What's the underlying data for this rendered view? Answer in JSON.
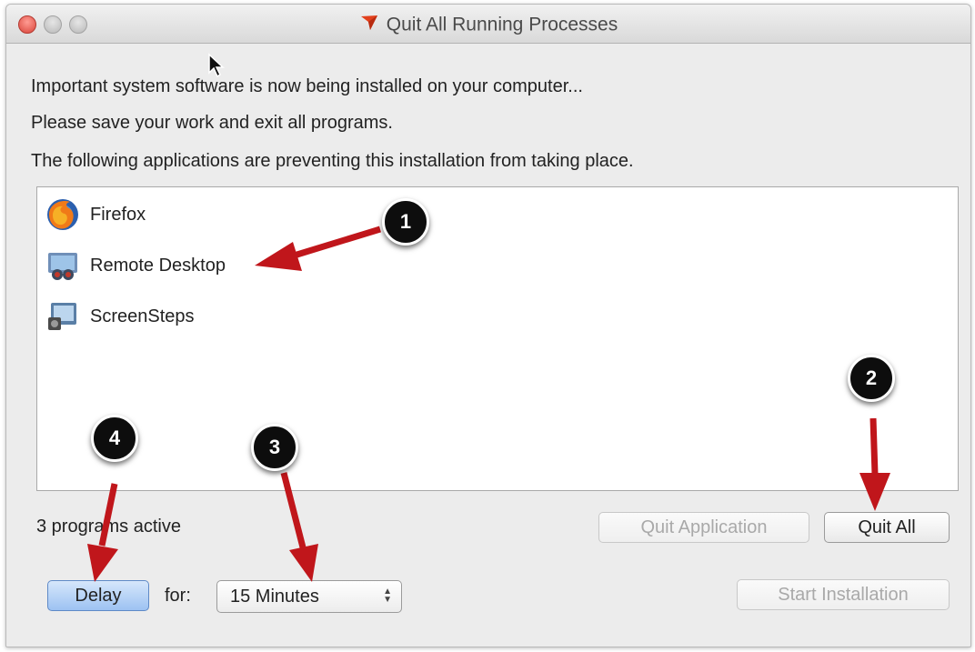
{
  "window": {
    "title": "Quit All Running Processes"
  },
  "message": {
    "line1": "Important system software is now being installed on your computer...",
    "line2": "Please save your work and exit all programs.",
    "line3": "The following applications are preventing this installation from taking place."
  },
  "apps": [
    {
      "label": "Firefox",
      "icon": "firefox-icon"
    },
    {
      "label": "Remote Desktop",
      "icon": "remote-desktop-icon"
    },
    {
      "label": "ScreenSteps",
      "icon": "screensteps-icon"
    }
  ],
  "status": {
    "programs_active": "3 programs active"
  },
  "buttons": {
    "quit_application": "Quit Application",
    "quit_all": "Quit All",
    "delay": "Delay",
    "start_installation": "Start Installation"
  },
  "delay": {
    "for_label": "for:",
    "selected": "15 Minutes"
  },
  "annotations": {
    "badge1": "1",
    "badge2": "2",
    "badge3": "3",
    "badge4": "4",
    "arrow_color": "#c0161b"
  }
}
